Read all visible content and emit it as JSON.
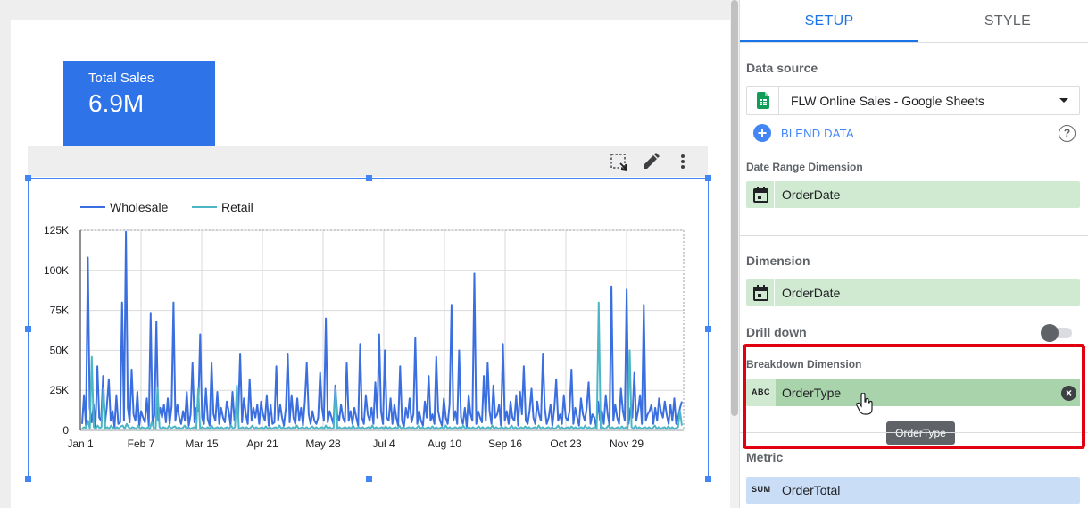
{
  "scorecard": {
    "label": "Total Sales",
    "value": "6.9M"
  },
  "chart_toolbar": {
    "icons": [
      "select-area-icon",
      "pencil-icon",
      "more-vert-icon"
    ]
  },
  "chart_data": {
    "type": "line",
    "title": "",
    "xlabel": "",
    "ylabel": "",
    "ylim": [
      0,
      125000
    ],
    "y_ticks": [
      "0",
      "25K",
      "50K",
      "75K",
      "100K",
      "125K"
    ],
    "x_ticks": [
      "Jan 1",
      "Feb 7",
      "Mar 15",
      "Apr 21",
      "May 28",
      "Jul 4",
      "Aug 10",
      "Sep 16",
      "Oct 23",
      "Nov 29"
    ],
    "legend_position": "top-left",
    "grid": true,
    "series": [
      {
        "name": "Wholesale",
        "color": "#3b6fe0",
        "values": [
          4000,
          22000,
          3000,
          108000,
          14000,
          5000,
          16000,
          2000,
          40000,
          8000,
          6000,
          34000,
          4000,
          15000,
          32000,
          6000,
          12000,
          2000,
          22000,
          4000,
          5000,
          80000,
          6000,
          124000,
          14000,
          5000,
          38000,
          10000,
          6000,
          24000,
          3000,
          12000,
          8000,
          5000,
          20000,
          3000,
          73000,
          4000,
          10000,
          68000,
          6000,
          14000,
          8000,
          16000,
          5000,
          20000,
          4000,
          15000,
          80000,
          6000,
          16000,
          8000,
          4000,
          12000,
          6000,
          24000,
          3000,
          10000,
          42000,
          5000,
          14000,
          12000,
          60000,
          8000,
          4000,
          26000,
          7000,
          3000,
          42000,
          10000,
          6000,
          24000,
          4000,
          14000,
          8000,
          5000,
          18000,
          12000,
          3000,
          24000,
          6000,
          16000,
          8000,
          48000,
          5000,
          20000,
          10000,
          4000,
          32000,
          6000,
          14000,
          8000,
          16000,
          4000,
          18000,
          10000,
          6000,
          22000,
          3000,
          16000,
          4000,
          5000,
          40000,
          6000,
          16000,
          8000,
          3000,
          14000,
          48000,
          5000,
          22000,
          8000,
          4000,
          20000,
          6000,
          14000,
          3000,
          18000,
          42000,
          10000,
          4000,
          12000,
          6000,
          4000,
          8000,
          36000,
          14000,
          6000,
          70000,
          5000,
          12000,
          8000,
          4000,
          28000,
          10000,
          6000,
          16000,
          8000,
          5000,
          42000,
          6000,
          12000,
          4000,
          14000,
          8000,
          3000,
          54000,
          8000,
          4000,
          22000,
          10000,
          6000,
          14000,
          4000,
          30000,
          8000,
          60000,
          12000,
          4000,
          50000,
          8000,
          6000,
          20000,
          4000,
          16000,
          8000,
          3000,
          40000,
          6000,
          2000,
          14000,
          8000,
          20000,
          5000,
          10000,
          58000,
          4000,
          12000,
          6000,
          3000,
          18000,
          8000,
          34000,
          6000,
          10000,
          4000,
          46000,
          12000,
          6000,
          3000,
          20000,
          8000,
          4000,
          16000,
          78000,
          6000,
          12000,
          4000,
          50000,
          8000,
          4000,
          14000,
          2000,
          22000,
          10000,
          6000,
          98000,
          4000,
          12000,
          8000,
          5000,
          34000,
          6000,
          42000,
          12000,
          4000,
          28000,
          8000,
          10000,
          16000,
          3000,
          54000,
          6000,
          12000,
          4000,
          18000,
          8000,
          6000,
          22000,
          3000,
          24000,
          10000,
          40000,
          6000,
          4000,
          12000,
          26000,
          8000,
          4000,
          18000,
          10000,
          6000,
          48000,
          14000,
          4000,
          8000,
          16000,
          3000,
          14000,
          32000,
          6000,
          10000,
          4000,
          22000,
          8000,
          6000,
          12000,
          38000,
          4000,
          14000,
          8000,
          3000,
          20000,
          10000,
          6000,
          14000,
          30000,
          4000,
          10000,
          8000,
          2000,
          18000,
          6000,
          12000,
          4000,
          22000,
          10000,
          3000,
          90000,
          6000,
          16000,
          8000,
          4000,
          26000,
          12000,
          6000,
          88000,
          4000,
          14000,
          8000,
          36000,
          6000,
          12000,
          22000,
          4000,
          78000,
          6000,
          10000,
          12000,
          16000,
          4000,
          14000,
          6000,
          20000,
          12000,
          8000,
          18000,
          10000,
          4000,
          16000,
          6000,
          20000,
          4000,
          8000,
          14000,
          18000
        ],
        "note_unused": ""
      },
      {
        "name": "Retail",
        "color": "#4db6c6",
        "values": [
          1000,
          2000,
          1500,
          6000,
          1000,
          46000,
          2000,
          1000,
          3000,
          1500,
          2000,
          26000,
          1000,
          2000,
          1000,
          3000,
          1500,
          1000,
          2000,
          1000,
          2500,
          3000,
          1000,
          4000,
          2000,
          1000,
          2000,
          1500,
          1000,
          3000,
          1000,
          2000,
          1500,
          1000,
          2000,
          1000,
          5000,
          1500,
          1000,
          27000,
          2000,
          1000,
          2000,
          1500,
          1000,
          3000,
          1000,
          2000,
          2500,
          1000,
          2000,
          1000,
          1500,
          3000,
          1000,
          2000,
          1000,
          1500,
          2000,
          1000,
          26000,
          1000,
          2000,
          1500,
          1000,
          2000,
          1000,
          3000,
          1000,
          1500,
          2000,
          1000,
          2000,
          1000,
          1500,
          2000,
          1000,
          3000,
          1000,
          2000,
          28000,
          1000,
          1500,
          2000,
          1000,
          2000,
          1000,
          1500,
          3000,
          1000,
          2000,
          1000,
          1500,
          2000,
          1000,
          2500,
          1000,
          2000,
          1000,
          1500,
          2000,
          1000,
          3000,
          1000,
          2000,
          1000,
          1500,
          2000,
          1000,
          2000,
          1000,
          3000,
          1000,
          1500,
          2000,
          1000,
          2000,
          1000,
          1500,
          2500,
          1000,
          2000,
          1000,
          1500,
          2000,
          1000,
          3000,
          1000,
          2000,
          1000,
          1500,
          26000,
          1000,
          2000,
          1000,
          1500,
          2000,
          1000,
          2000,
          1000,
          3000,
          1000,
          1500,
          2000,
          1000,
          2000,
          1000,
          1500,
          2000,
          1000,
          3000,
          1000,
          2000,
          1000,
          1500,
          2000,
          1000,
          2500,
          1000,
          2000,
          1000,
          1500,
          2000,
          1000,
          3000,
          1000,
          2000,
          1000,
          1500,
          2000,
          1000,
          2000,
          1000,
          1500,
          3000,
          1000,
          2000,
          1000,
          1500,
          2000,
          1000,
          2500,
          1000,
          2000,
          1000,
          1500,
          2000,
          1000,
          3000,
          1000,
          2000,
          1000,
          1500,
          2000,
          1000,
          2000,
          1000,
          3000,
          1000,
          1500,
          2000,
          1000,
          2000,
          1000,
          1500,
          2500,
          1000,
          2000,
          1000,
          1500,
          2000,
          1000,
          3000,
          1000,
          2000,
          1000,
          1500,
          2000,
          1000,
          2000,
          1000,
          1500,
          3000,
          1000,
          2000,
          1000,
          1500,
          2000,
          1000,
          2500,
          1000,
          2000,
          1000,
          1500,
          2000,
          1000,
          3000,
          1000,
          2000,
          1000,
          1500,
          2000,
          1000,
          2000,
          1000,
          1500,
          3000,
          1000,
          2000,
          1000,
          1500,
          2000,
          1000,
          2500,
          1000,
          2000,
          1000,
          1500,
          2000,
          1000,
          3000,
          1000,
          2000,
          1000,
          1500,
          2000,
          1000,
          80000,
          1000,
          2000,
          1000,
          1500,
          3000,
          1000,
          2000,
          1000,
          1500,
          2000,
          1000,
          2500,
          1000,
          2000,
          1000,
          50000,
          2000,
          1000,
          3000,
          1000,
          2000,
          1000,
          1500,
          2000,
          1000,
          2000,
          1000,
          1500,
          3000,
          1000,
          2000,
          1000,
          1500,
          2000,
          1000,
          2500,
          1000,
          2000,
          1000,
          1500,
          2000,
          12000,
          3000
        ]
      }
    ]
  },
  "tabs": [
    {
      "label": "SETUP",
      "active": true
    },
    {
      "label": "STYLE",
      "active": false
    }
  ],
  "data_source": {
    "label": "Data source",
    "value": "FLW Online Sales - Google Sheets",
    "icon": "google-sheets-icon",
    "blend_label": "BLEND DATA",
    "help": "?"
  },
  "date_range": {
    "label": "Date Range Dimension",
    "value": "OrderDate",
    "icon": "calendar-icon"
  },
  "dimension": {
    "label": "Dimension",
    "value": "OrderDate",
    "icon": "calendar-icon"
  },
  "drill_down": {
    "label": "Drill down",
    "enabled": false
  },
  "breakdown": {
    "label": "Breakdown Dimension",
    "tag": "ABC",
    "value": "OrderType",
    "tooltip": "OrderType"
  },
  "metric": {
    "label": "Metric",
    "tag": "SUM",
    "value": "OrderTotal"
  },
  "colors": {
    "accent": "#1a73e8",
    "scorecard": "#2f73e8",
    "dim_chip": "#d0e9d1",
    "metric_chip": "#c9ddf7",
    "highlight": "#e0000f"
  }
}
